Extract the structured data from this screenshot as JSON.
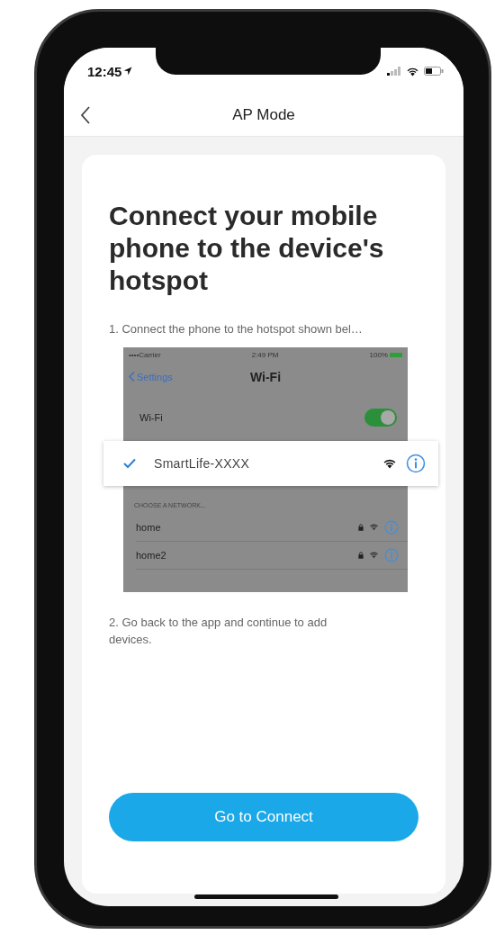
{
  "status_bar": {
    "time": "12:45"
  },
  "nav": {
    "title": "AP Mode"
  },
  "card": {
    "title": "Connect your mobile phone to the device's hotspot",
    "step_1": "1. Connect the phone to the hotspot shown bel…",
    "illustration": {
      "status_bar": {
        "carrier": "••••Carrier",
        "time": "2:49 PM",
        "battery": "100%"
      },
      "back_label": "Settings",
      "title": "Wi-Fi",
      "wifi_row": {
        "label": "Wi-Fi",
        "on": true
      },
      "selected_network": {
        "name": "SmartLife-XXXX",
        "checked": true
      },
      "section_header": "CHOOSE A NETWORK...",
      "networks": [
        {
          "name": "home"
        },
        {
          "name": "home2"
        }
      ]
    },
    "step_2": "2. Go back to the app and continue to add devices.",
    "button": "Go to Connect"
  }
}
